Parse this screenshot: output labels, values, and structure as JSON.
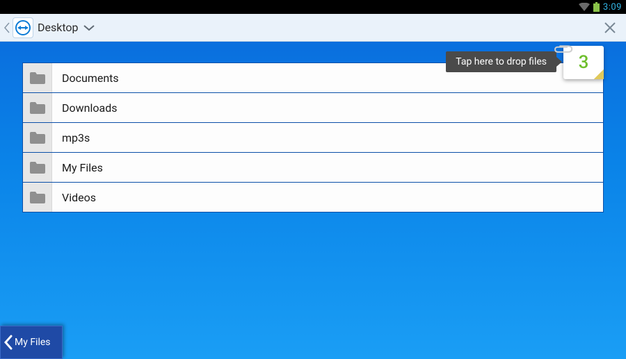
{
  "status": {
    "time": "3:09"
  },
  "header": {
    "breadcrumb": "Desktop"
  },
  "drop": {
    "hint": "Tap here to drop files",
    "count": "3"
  },
  "folders": [
    {
      "label": "Documents"
    },
    {
      "label": "Downloads"
    },
    {
      "label": "mp3s"
    },
    {
      "label": "My Files"
    },
    {
      "label": "Videos"
    }
  ],
  "bottom": {
    "label": "My Files"
  }
}
